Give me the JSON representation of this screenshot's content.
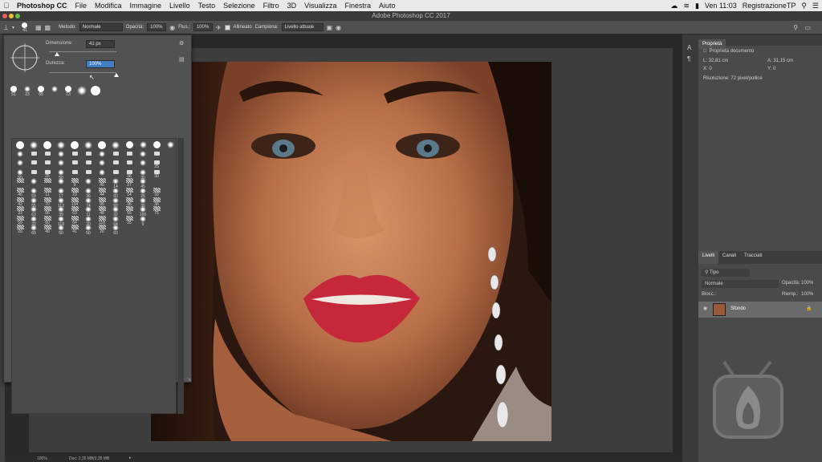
{
  "menubar": {
    "app": "Photoshop CC",
    "items": [
      "File",
      "Modifica",
      "Immagine",
      "Livello",
      "Testo",
      "Selezione",
      "Filtro",
      "3D",
      "Visualizza",
      "Finestra",
      "Aiuto"
    ],
    "clock": "Ven 11:03",
    "user": "RegistrazioneTP"
  },
  "window": {
    "title": "Adobe Photoshop CC 2017"
  },
  "options": {
    "brush_size": "41",
    "metodo_label": "Metodo:",
    "metodo_value": "Normale",
    "opacita_label": "Opacità:",
    "opacita_value": "100%",
    "flusso_label": "Flus.:",
    "flusso_value": "100%",
    "allineato_label": "Allineato",
    "campione_label": "Campiona:",
    "campione_value": "Livello attuale"
  },
  "brush_picker": {
    "dimensione_label": "Dimensione:",
    "dimensione_value": "41 px",
    "durezza_label": "Durezza:",
    "durezza_value": "100%",
    "dimensione_level": 0.12,
    "durezza_level": 1.0,
    "recent": [
      "51",
      "23",
      "65",
      "",
      "13",
      "",
      ""
    ],
    "grid_labels": [
      [
        "",
        "",
        "",
        "",
        "",
        "",
        "",
        "",
        "",
        "",
        "",
        ""
      ],
      [
        "",
        "",
        "",
        "",
        "",
        "",
        "",
        "",
        "",
        "",
        ""
      ],
      [
        "",
        "",
        "",
        "",
        "",
        "",
        "",
        "",
        "",
        "",
        "25"
      ],
      [
        "50",
        "",
        "25",
        "50",
        "",
        "",
        "",
        "",
        "36",
        "30",
        "30"
      ],
      [
        "",
        "",
        "",
        "",
        "9",
        "",
        "45",
        "14",
        "27",
        "45"
      ],
      [
        "46",
        "59",
        "11",
        "17",
        "23",
        "36",
        "44",
        "60",
        "14",
        "26",
        "33"
      ],
      [
        "42",
        "55",
        "70",
        "112",
        "134",
        "74",
        "95",
        "90",
        "36",
        "36",
        "36"
      ],
      [
        "33",
        "63",
        "66",
        "39",
        "63",
        "11",
        "48",
        "32",
        "55",
        "100",
        "75"
      ],
      [
        "50",
        "20",
        "60",
        "118",
        "64",
        "20",
        "118",
        "64",
        "25",
        "9"
      ],
      [
        "20",
        "60",
        "49",
        "50",
        "41",
        "50",
        "20",
        "60"
      ]
    ]
  },
  "status": {
    "zoom": "100%",
    "doc": "Doc: 2,35 MB/2,35 MB"
  },
  "properties": {
    "tab": "Proprietà",
    "doc_label": "Proprietà documento",
    "L": "L: 32,81 cm",
    "A": "A: 31,15 cm",
    "X": "X: 0",
    "Y": "Y: 0",
    "resolution": "Risoluzione: 72 pixel/pollice"
  },
  "layers": {
    "tabs": [
      "Livelli",
      "Canali",
      "Tracciati"
    ],
    "filter_placeholder": "Tipo",
    "blend": "Normale",
    "opacity_label": "Opacità:",
    "opacity_value": "100%",
    "lock_label": "Blocc.:",
    "fill_label": "Riemp.:",
    "fill_value": "100%",
    "layer_name": "Sfondo"
  },
  "colors": {
    "accent": "#3f7cc0",
    "menubar": "#e9e9e9",
    "panel": "#4a4a4a",
    "lips": "#c5283a"
  }
}
